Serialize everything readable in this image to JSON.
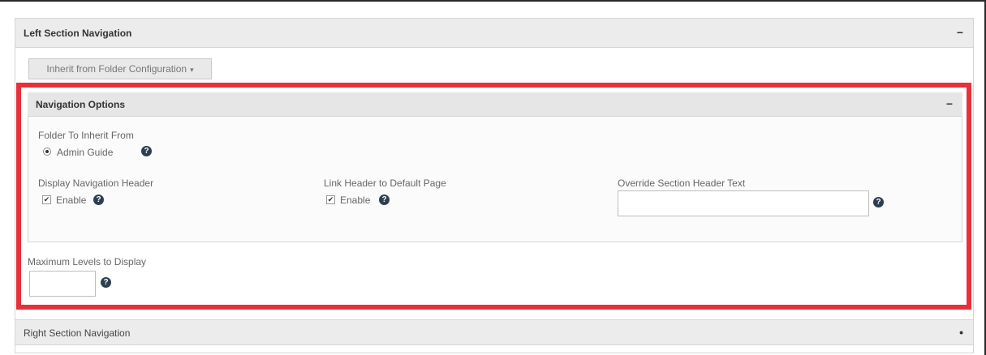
{
  "left_section": {
    "title": "Left Section Navigation",
    "toggle": "−",
    "inherit_dropdown": {
      "label": "Inherit from Folder Configuration",
      "caret": "▾"
    }
  },
  "navigation_options": {
    "title": "Navigation Options",
    "toggle": "−",
    "folder_to_inherit": {
      "label": "Folder To Inherit From",
      "selected_option": "Admin Guide",
      "help": "?"
    },
    "display_nav_header": {
      "label": "Display Navigation Header",
      "checkbox_label": "Enable",
      "checked": true,
      "help": "?"
    },
    "link_header": {
      "label": "Link Header to Default Page",
      "checkbox_label": "Enable",
      "checked": true,
      "help": "?"
    },
    "override_header_text": {
      "label": "Override Section Header Text",
      "value": "",
      "help": "?"
    }
  },
  "max_levels": {
    "label": "Maximum Levels to Display",
    "value": "",
    "help": "?"
  },
  "right_section": {
    "title": "Right Section Navigation",
    "toggle": "•"
  },
  "colors": {
    "highlight_border": "#e8303a",
    "help_icon": "#2d3e50",
    "panel_header": "#ececec"
  },
  "checkmark": "✔"
}
